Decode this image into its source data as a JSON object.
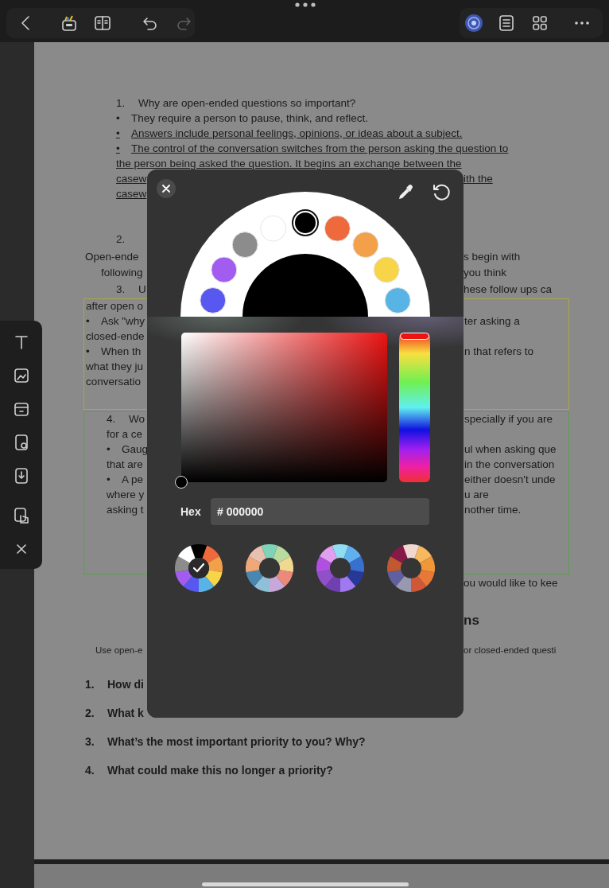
{
  "toolbar": {
    "left": [
      {
        "disabled": false
      },
      {
        "disabled": false
      },
      {
        "disabled": false
      },
      {
        "disabled": false
      },
      {
        "disabled": true
      }
    ],
    "right": [
      {
        "disabled": false
      },
      {
        "disabled": false
      },
      {
        "disabled": false
      },
      {
        "disabled": false
      }
    ]
  },
  "document": {
    "blocks": [
      {
        "kind": "plain",
        "marker": "1.",
        "text": "Why are open-ended questions so important?"
      },
      {
        "kind": "plain",
        "marker": "•",
        "text": "They require a person to pause, think, and reflect."
      },
      {
        "kind": "underlined",
        "marker": "•",
        "text": "Answers include personal feelings, opinions, or ideas about a subject."
      },
      {
        "kind": "underlined",
        "marker": "•",
        "text": "The control of the conversation switches from the person asking the question to"
      },
      {
        "kind": "underlined",
        "text": "the person being asked the question. It begins an exchange between the"
      },
      {
        "kind": "underlined",
        "left": "casew",
        "right": "ith the"
      },
      {
        "kind": "underlined",
        "left": "casew"
      },
      {
        "kind": "plain",
        "marker": "2."
      },
      {
        "kind": "plain",
        "left": "Open-ende",
        "right": "s begin with"
      },
      {
        "kind": "plain",
        "left": "following",
        "right": "you think"
      },
      {
        "kind": "plain",
        "marker": "3.",
        "left": "U",
        "right": "hese follow ups ca"
      },
      {
        "kind": "box",
        "color": "#a8a84a",
        "lines": [
          {
            "left": "after open o"
          },
          {
            "marker": "•",
            "left": "Ask \"why",
            "right": "ter asking a"
          },
          {
            "left": "closed-ende"
          },
          {
            "marker": "•",
            "left": "When th",
            "right": "n that refers to"
          },
          {
            "left": "what they ju"
          },
          {
            "left": "conversatio"
          }
        ]
      },
      {
        "kind": "box",
        "color": "#5e9e52",
        "lines": [
          {
            "marker": "4.",
            "left": "Wo",
            "right": "specially if you are"
          },
          {
            "left": "for a ce"
          },
          {
            "marker": "•",
            "left": "Gaug",
            "right": "ul when asking que"
          },
          {
            "left": "that are",
            "right": "in the conversation"
          },
          {
            "marker": "•",
            "left": "A pe",
            "right": "either doesn't unde"
          },
          {
            "left": "where y",
            "right": "u are"
          },
          {
            "left": "asking t",
            "right": "nother time."
          }
        ]
      },
      {
        "kind": "plain",
        "right": "ou would like to kee"
      },
      {
        "kind": "heading",
        "right": "ns"
      },
      {
        "kind": "small",
        "left": "Use open-e",
        "right": "or closed-ended questi"
      },
      {
        "kind": "bold",
        "marker": "1.",
        "left": "How di"
      },
      {
        "kind": "bold",
        "marker": "2.",
        "left": "What k"
      },
      {
        "kind": "bold",
        "marker": "3.",
        "text": "What’s the most important priority to you? Why?"
      },
      {
        "kind": "bold",
        "marker": "4.",
        "text": "What could make this no longer a priority?"
      }
    ]
  },
  "picker": {
    "swatches": [
      {
        "color": "#5858f0",
        "selected": false
      },
      {
        "color": "#a35cf0",
        "selected": false
      },
      {
        "color": "#8c8c8c",
        "selected": false
      },
      {
        "color": "#ffffff",
        "selected": false
      },
      {
        "color": "#000000",
        "selected": true
      },
      {
        "color": "#ee6a3c",
        "selected": false
      },
      {
        "color": "#f2a04a",
        "selected": false
      },
      {
        "color": "#f8d448",
        "selected": false
      },
      {
        "color": "#58b4e4",
        "selected": false
      }
    ],
    "hue": {
      "level": 0
    },
    "saturation": {
      "level": 0
    },
    "brightness": {
      "level": 0
    },
    "hex": {
      "label": "Hex",
      "value": "# 000000"
    },
    "palettes": [
      {
        "selected": true,
        "segments": [
          {
            "color": "#000000"
          },
          {
            "color": "#ee6a3c"
          },
          {
            "color": "#f2a04a"
          },
          {
            "color": "#f8d448"
          },
          {
            "color": "#58b4e4"
          },
          {
            "color": "#5858f0"
          },
          {
            "color": "#a35cf0"
          },
          {
            "color": "#8c8c8c"
          },
          {
            "color": "#ffffff"
          }
        ]
      },
      {
        "selected": false,
        "segments": [
          {
            "color": "#7fd3b8"
          },
          {
            "color": "#b8dba0"
          },
          {
            "color": "#f0d890"
          },
          {
            "color": "#ec8a7a"
          },
          {
            "color": "#c8a8d8"
          },
          {
            "color": "#90c0d8"
          },
          {
            "color": "#4888b0"
          },
          {
            "color": "#f0a878"
          },
          {
            "color": "#e8c0b0"
          }
        ]
      },
      {
        "selected": false,
        "segments": [
          {
            "color": "#90dcf0"
          },
          {
            "color": "#60b0f0"
          },
          {
            "color": "#3870d0"
          },
          {
            "color": "#283898"
          },
          {
            "color": "#a078f0"
          },
          {
            "color": "#7040b0"
          },
          {
            "color": "#9050c8"
          },
          {
            "color": "#b050e0"
          },
          {
            "color": "#e0a0f0"
          }
        ]
      },
      {
        "selected": false,
        "segments": [
          {
            "color": "#f0d8d0"
          },
          {
            "color": "#f8b860"
          },
          {
            "color": "#f09838"
          },
          {
            "color": "#e87838"
          },
          {
            "color": "#d05838"
          },
          {
            "color": "#9898b0"
          },
          {
            "color": "#6060a0"
          },
          {
            "color": "#c05830"
          },
          {
            "color": "#881848"
          }
        ]
      }
    ]
  }
}
